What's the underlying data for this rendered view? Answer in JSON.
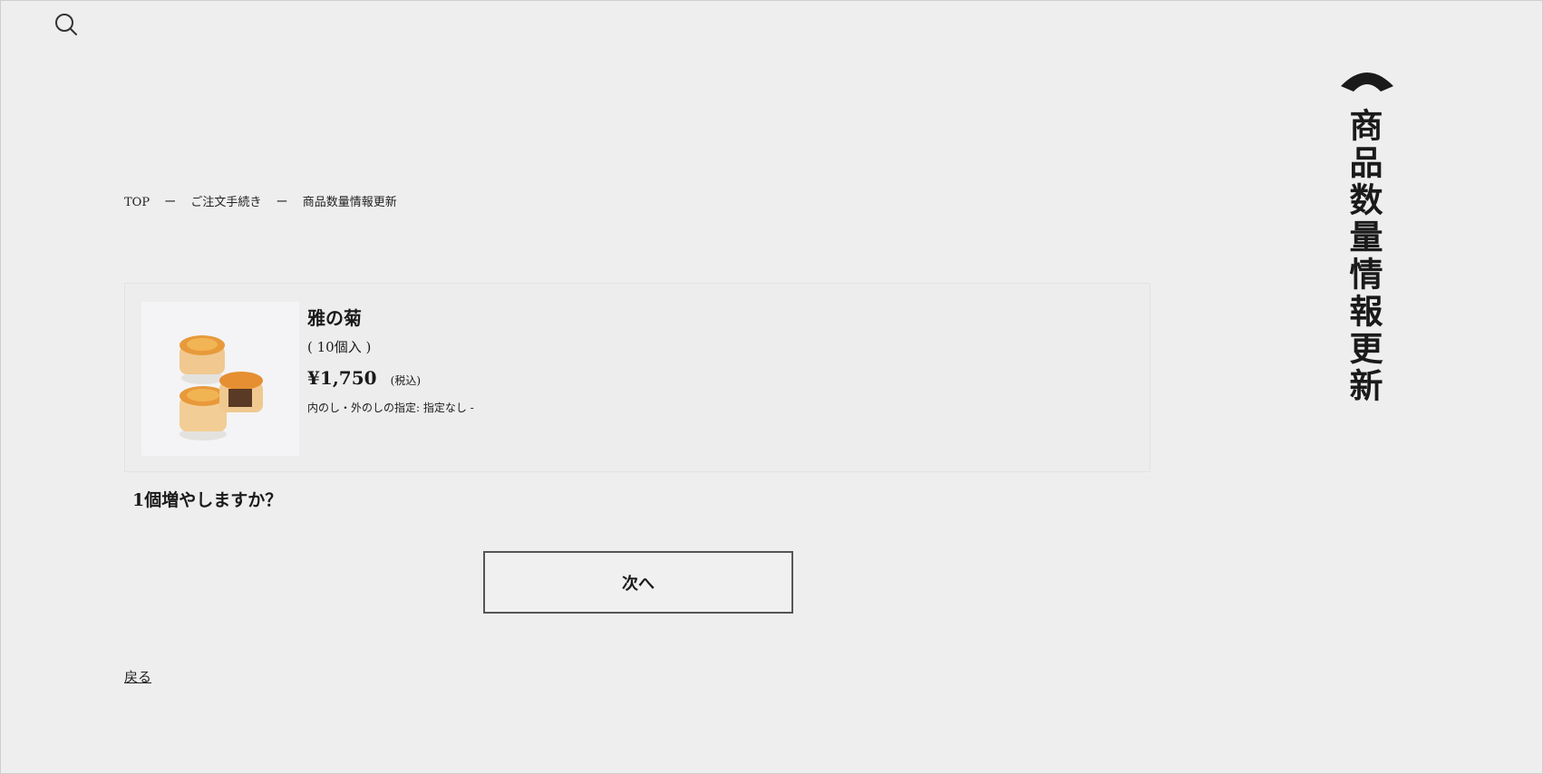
{
  "header": {
    "search_icon": "search-icon"
  },
  "page_title": "商品数量情報更新",
  "breadcrumb": {
    "items": [
      "TOP",
      "ご注文手続き",
      "商品数量情報更新"
    ],
    "separator": "ー"
  },
  "product": {
    "name": "雅の菊",
    "quantity": "( 10個入 )",
    "price": "¥1,750",
    "tax_note": "(税込)",
    "noshi": "内のし・外のしの指定: 指定なし -"
  },
  "question": "1個増やしますか？",
  "next_button": "次へ",
  "back_link": "戻る",
  "colors": {
    "background": "#eeeeee",
    "text": "#1a1a1a",
    "button_border": "#555555"
  }
}
